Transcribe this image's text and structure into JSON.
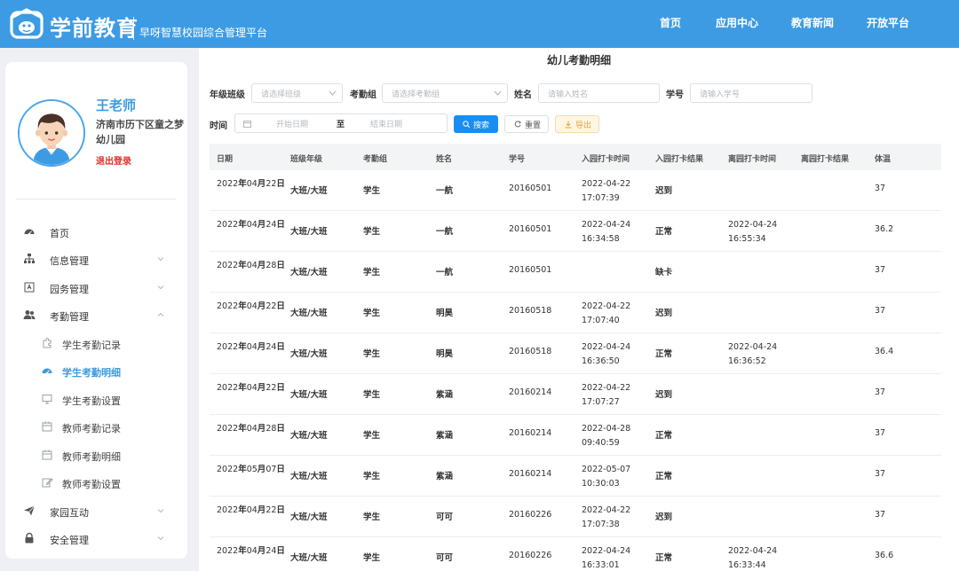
{
  "header": {
    "logo_text": "学前教育",
    "logo_sub": "早呀智慧校园综合管理平台",
    "nav": [
      "首页",
      "应用中心",
      "教育新闻",
      "开放平台"
    ]
  },
  "user": {
    "name": "王老师",
    "school": "济南市历下区童之梦幼儿园",
    "logout": "退出登录"
  },
  "menu": [
    {
      "label": "首页",
      "icon": "dashboard-icon",
      "sub": false,
      "active": false,
      "arrow": "none"
    },
    {
      "label": "信息管理",
      "icon": "org-chart-icon",
      "sub": false,
      "active": false,
      "arrow": "down"
    },
    {
      "label": "园务管理",
      "icon": "id-card-icon",
      "sub": false,
      "active": false,
      "arrow": "down"
    },
    {
      "label": "考勤管理",
      "icon": "user-group-icon",
      "sub": false,
      "active": false,
      "arrow": "up"
    },
    {
      "label": "学生考勤记录",
      "icon": "puzzle-icon",
      "sub": true,
      "active": false,
      "arrow": "none"
    },
    {
      "label": "学生考勤明细",
      "icon": "dashboard-icon",
      "sub": true,
      "active": true,
      "arrow": "none"
    },
    {
      "label": "学生考勤设置",
      "icon": "monitor-icon",
      "sub": true,
      "active": false,
      "arrow": "none"
    },
    {
      "label": "教师考勤记录",
      "icon": "calendar-icon",
      "sub": true,
      "active": false,
      "arrow": "none"
    },
    {
      "label": "教师考勤明细",
      "icon": "calendar-icon",
      "sub": true,
      "active": false,
      "arrow": "none"
    },
    {
      "label": "教师考勤设置",
      "icon": "edit-icon",
      "sub": true,
      "active": false,
      "arrow": "none"
    },
    {
      "label": "家园互动",
      "icon": "send-icon",
      "sub": false,
      "active": false,
      "arrow": "down"
    },
    {
      "label": "安全管理",
      "icon": "lock-icon",
      "sub": false,
      "active": false,
      "arrow": "down"
    }
  ],
  "page": {
    "title": "幼儿考勤明细"
  },
  "filters": {
    "class_label": "年级班级",
    "class_placeholder": "请选择班级",
    "group_label": "考勤组",
    "group_placeholder": "请选择考勤组",
    "name_label": "姓名",
    "name_placeholder": "请输入姓名",
    "id_label": "学号",
    "id_placeholder": "请输入学号",
    "time_label": "时间",
    "start_placeholder": "开始日期",
    "range_sep": "至",
    "end_placeholder": "结束日期",
    "search_btn": "搜索",
    "reset_btn": "重置",
    "export_btn": "导出"
  },
  "table": {
    "headers": [
      "日期",
      "班级年级",
      "考勤组",
      "姓名",
      "学号",
      "入园打卡时间",
      "入园打卡结果",
      "离园打卡时间",
      "离园打卡结果",
      "体温"
    ],
    "rows": [
      {
        "date": "2022年04月22日",
        "cls": "大班/大班",
        "group": "学生",
        "name": "一航",
        "sid": "20160501",
        "in_time": "2022-04-22 17:07:39",
        "in_result": "迟到",
        "out_time": "",
        "out_result": "",
        "temp": "37"
      },
      {
        "date": "2022年04月24日",
        "cls": "大班/大班",
        "group": "学生",
        "name": "一航",
        "sid": "20160501",
        "in_time": "2022-04-24 16:34:58",
        "in_result": "正常",
        "out_time": "2022-04-24 16:55:34",
        "out_result": "",
        "temp": "36.2"
      },
      {
        "date": "2022年04月28日",
        "cls": "大班/大班",
        "group": "学生",
        "name": "一航",
        "sid": "20160501",
        "in_time": "",
        "in_result": "缺卡",
        "out_time": "",
        "out_result": "",
        "temp": "37"
      },
      {
        "date": "2022年04月22日",
        "cls": "大班/大班",
        "group": "学生",
        "name": "明昊",
        "sid": "20160518",
        "in_time": "2022-04-22 17:07:40",
        "in_result": "迟到",
        "out_time": "",
        "out_result": "",
        "temp": "37"
      },
      {
        "date": "2022年04月24日",
        "cls": "大班/大班",
        "group": "学生",
        "name": "明昊",
        "sid": "20160518",
        "in_time": "2022-04-24 16:36:50",
        "in_result": "正常",
        "out_time": "2022-04-24 16:36:52",
        "out_result": "",
        "temp": "36.4"
      },
      {
        "date": "2022年04月22日",
        "cls": "大班/大班",
        "group": "学生",
        "name": "紫涵",
        "sid": "20160214",
        "in_time": "2022-04-22 17:07:27",
        "in_result": "迟到",
        "out_time": "",
        "out_result": "",
        "temp": "37"
      },
      {
        "date": "2022年04月28日",
        "cls": "大班/大班",
        "group": "学生",
        "name": "紫涵",
        "sid": "20160214",
        "in_time": "2022-04-28 09:40:59",
        "in_result": "正常",
        "out_time": "",
        "out_result": "",
        "temp": "37"
      },
      {
        "date": "2022年05月07日",
        "cls": "大班/大班",
        "group": "学生",
        "name": "紫涵",
        "sid": "20160214",
        "in_time": "2022-05-07 10:30:03",
        "in_result": "正常",
        "out_time": "",
        "out_result": "",
        "temp": "37"
      },
      {
        "date": "2022年04月22日",
        "cls": "大班/大班",
        "group": "学生",
        "name": "可可",
        "sid": "20160226",
        "in_time": "2022-04-22 17:07:38",
        "in_result": "迟到",
        "out_time": "",
        "out_result": "",
        "temp": "37"
      },
      {
        "date": "2022年04月24日",
        "cls": "大班/大班",
        "group": "学生",
        "name": "可可",
        "sid": "20160226",
        "in_time": "2022-04-24 16:33:01",
        "in_result": "正常",
        "out_time": "2022-04-24 16:33:44",
        "out_result": "",
        "temp": "36.6"
      }
    ]
  },
  "colors": {
    "header_bg": "#3d9be3",
    "accent": "#3d9be3",
    "logout": "#e0302b",
    "search_btn": "#1a8ef0",
    "export_bg": "#fdf6e3",
    "export_text": "#e6a23c"
  }
}
